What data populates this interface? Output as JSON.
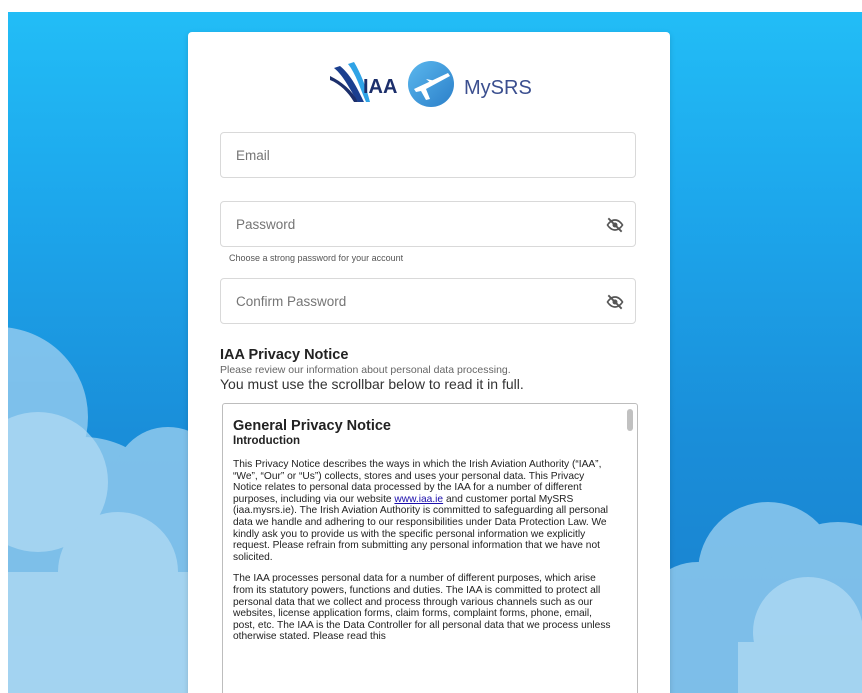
{
  "brand": {
    "iaa_text": "IAA",
    "app_name": "MySRS",
    "iaa_color": "#1c2f6b",
    "app_color": "#3b4f8f"
  },
  "form": {
    "email": {
      "placeholder": "Email",
      "value": ""
    },
    "password": {
      "placeholder": "Password",
      "value": "",
      "hint": "Choose a strong password for your account",
      "toggle_icon": "eye-off-icon"
    },
    "confirm_password": {
      "placeholder": "Confirm Password",
      "value": "",
      "toggle_icon": "eye-off-icon"
    }
  },
  "privacy": {
    "title": "IAA Privacy Notice",
    "subtitle": "Please review our information about personal data processing.",
    "must_read": "You must use the scrollbar below to read it in full.",
    "notice": {
      "title": "General Privacy Notice",
      "subtitle": "Introduction",
      "para1_a": "This Privacy Notice describes the ways in which the Irish Aviation Authority (“IAA”, “We”, “Our” or “Us”) collects, stores and uses your personal data. This Privacy Notice relates to personal data processed by the IAA for a number of different purposes, including via our website ",
      "para1_link": "www.iaa.ie",
      "para1_b": " and customer portal MySRS (iaa.mysrs.ie). The Irish Aviation Authority is committed to safeguarding all personal data we handle and adhering to our responsibilities under Data Protection Law. We kindly ask you to provide us with the specific personal information we explicitly request. Please refrain from submitting any personal information that we have not solicited.",
      "para2": "The IAA processes personal data for a number of different purposes, which arise from its statutory powers, functions and duties. The IAA is committed to protect all personal data that we collect and process through various channels such as our websites, license application forms, claim forms, complaint forms, phone, email, post, etc. The IAA is the Data Controller for all personal data that we process unless otherwise stated. Please read this"
    }
  },
  "colors": {
    "sky_top": "#22bdf6",
    "sky_bottom": "#1b7fcc",
    "cloud": "#9ccfee",
    "link": "#1a0dab"
  }
}
